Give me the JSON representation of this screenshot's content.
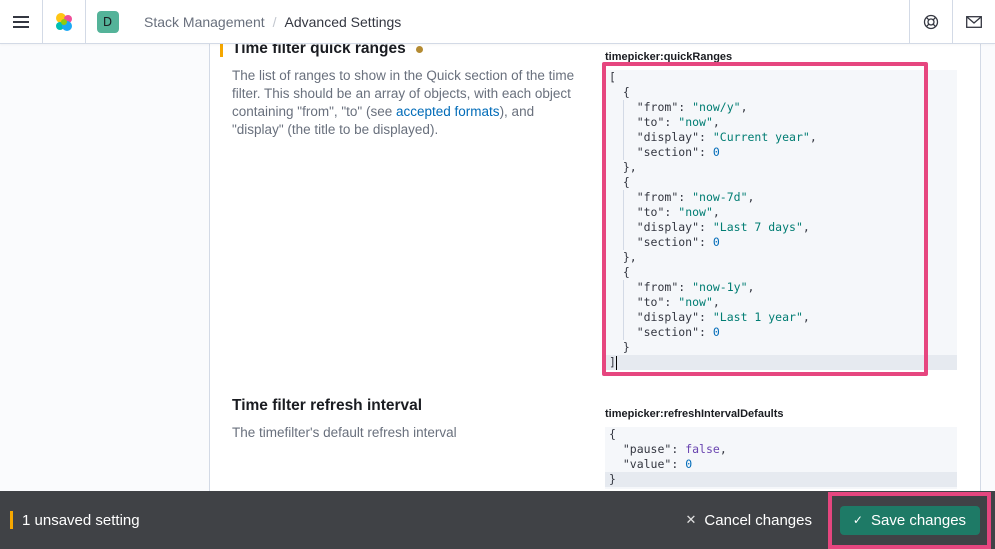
{
  "header": {
    "space_initial": "D",
    "breadcrumbs": [
      "Stack Management",
      "Advanced Settings"
    ]
  },
  "settings": [
    {
      "title": "Time filter quick ranges",
      "description_pre": "The list of ranges to show in the Quick section of the time filter. This should be an array of objects, with each object containing \"from\", \"to\" (see ",
      "description_link": "accepted formats",
      "description_post": "), and \"display\" (the title to be displayed).",
      "field_key": "timepicker:quickRanges",
      "unsaved": true
    },
    {
      "title": "Time filter refresh interval",
      "description": "The timefilter's default refresh interval",
      "field_key": "timepicker:refreshIntervalDefaults"
    }
  ],
  "quick_ranges": [
    {
      "from": "\"now/y\"",
      "to": "\"now\"",
      "display": "\"Current year\"",
      "section": "0"
    },
    {
      "from": "\"now-7d\"",
      "to": "\"now\"",
      "display": "\"Last 7 days\"",
      "section": "0"
    },
    {
      "from": "\"now-1y\"",
      "to": "\"now\"",
      "display": "\"Last 1 year\"",
      "section": "0"
    }
  ],
  "refresh_defaults": {
    "pause": "false",
    "value": "0"
  },
  "bottom_bar": {
    "unsaved_count_text": "1 unsaved setting",
    "cancel_label": "Cancel changes",
    "save_label": "Save changes"
  },
  "colors": {
    "accent": "#1e7a66",
    "highlight": "#e6467f",
    "unsaved": "#f5a700"
  }
}
